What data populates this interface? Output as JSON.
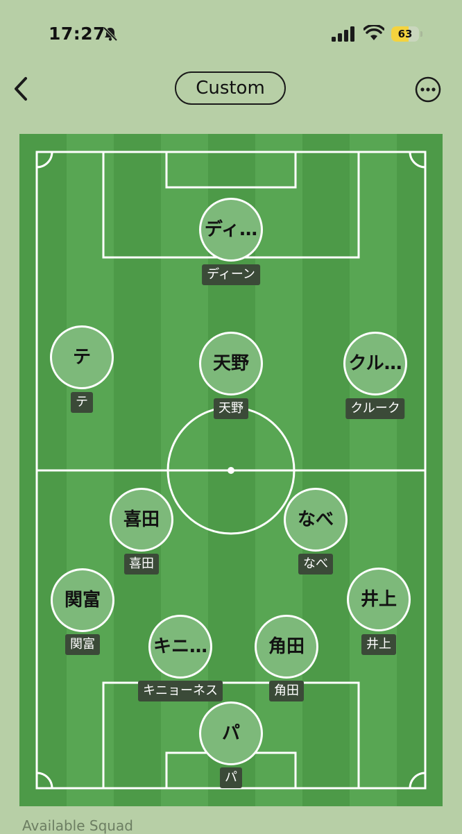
{
  "status_bar": {
    "time": "17:27",
    "battery": "63",
    "battery_level": 0.63
  },
  "nav": {
    "title": "Custom"
  },
  "players": [
    {
      "id": "gk-top",
      "circle": "ディ…",
      "name": "ディーン"
    },
    {
      "id": "lw",
      "circle": "テ",
      "name": "テ"
    },
    {
      "id": "st",
      "circle": "天野",
      "name": "天野"
    },
    {
      "id": "rw",
      "circle": "クル…",
      "name": "クルーク"
    },
    {
      "id": "lcm",
      "circle": "喜田",
      "name": "喜田"
    },
    {
      "id": "rcm",
      "circle": "なべ",
      "name": "なべ"
    },
    {
      "id": "lb",
      "circle": "関富",
      "name": "関富"
    },
    {
      "id": "rb",
      "circle": "井上",
      "name": "井上"
    },
    {
      "id": "lcb",
      "circle": "キニ…",
      "name": "キニョーネス"
    },
    {
      "id": "rcb",
      "circle": "角田",
      "name": "角田"
    },
    {
      "id": "gk",
      "circle": "パ",
      "name": "パ"
    }
  ],
  "footer": {
    "section_label": "Available Squad"
  },
  "colors": {
    "background": "#b7cfa6",
    "pitch_dark": "#4d9a48",
    "pitch_light": "#58a653",
    "battery": "#f4d33e"
  }
}
